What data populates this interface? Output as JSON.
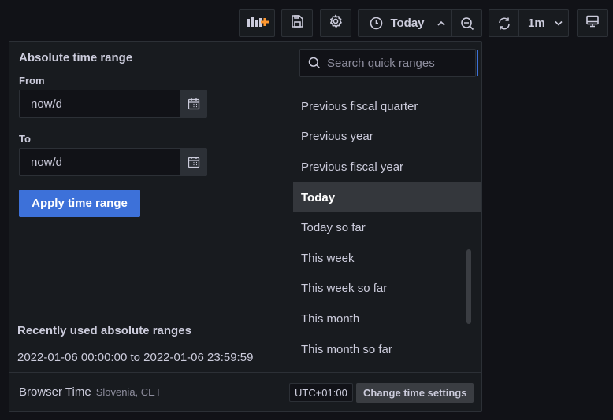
{
  "toolbar": {
    "add_panel_icon": "add-panel-icon",
    "save_icon": "save-icon",
    "settings_icon": "gear-icon",
    "time_picker": {
      "icon": "clock-icon",
      "label": "Today",
      "chevron": "chevron-up-icon"
    },
    "zoom_out_icon": "zoom-out-icon",
    "refresh": {
      "icon": "refresh-icon",
      "interval": "1m",
      "chevron": "chevron-down-icon"
    },
    "tv_mode_icon": "monitor-icon"
  },
  "absolute": {
    "title": "Absolute time range",
    "from_label": "From",
    "from_value": "now/d",
    "to_label": "To",
    "to_value": "now/d",
    "apply_label": "Apply time range"
  },
  "recent": {
    "title": "Recently used absolute ranges",
    "items": [
      "2022-01-06 00:00:00 to 2022-01-06 23:59:59"
    ]
  },
  "quick": {
    "search_placeholder": "Search quick ranges",
    "items": [
      "Previous fiscal quarter",
      "Previous year",
      "Previous fiscal year",
      "Today",
      "Today so far",
      "This week",
      "This week so far",
      "This month",
      "This month so far"
    ],
    "selected": "Today"
  },
  "footer": {
    "label": "Browser Time",
    "location": "Slovenia, CET",
    "utc_offset": "UTC+01:00",
    "change_label": "Change time settings"
  },
  "colors": {
    "background": "#111217",
    "panel": "#181b1f",
    "border": "#2c3036",
    "primary": "#3d71d9",
    "text": "#ccccdc",
    "accent_orange": "#ff9830"
  }
}
